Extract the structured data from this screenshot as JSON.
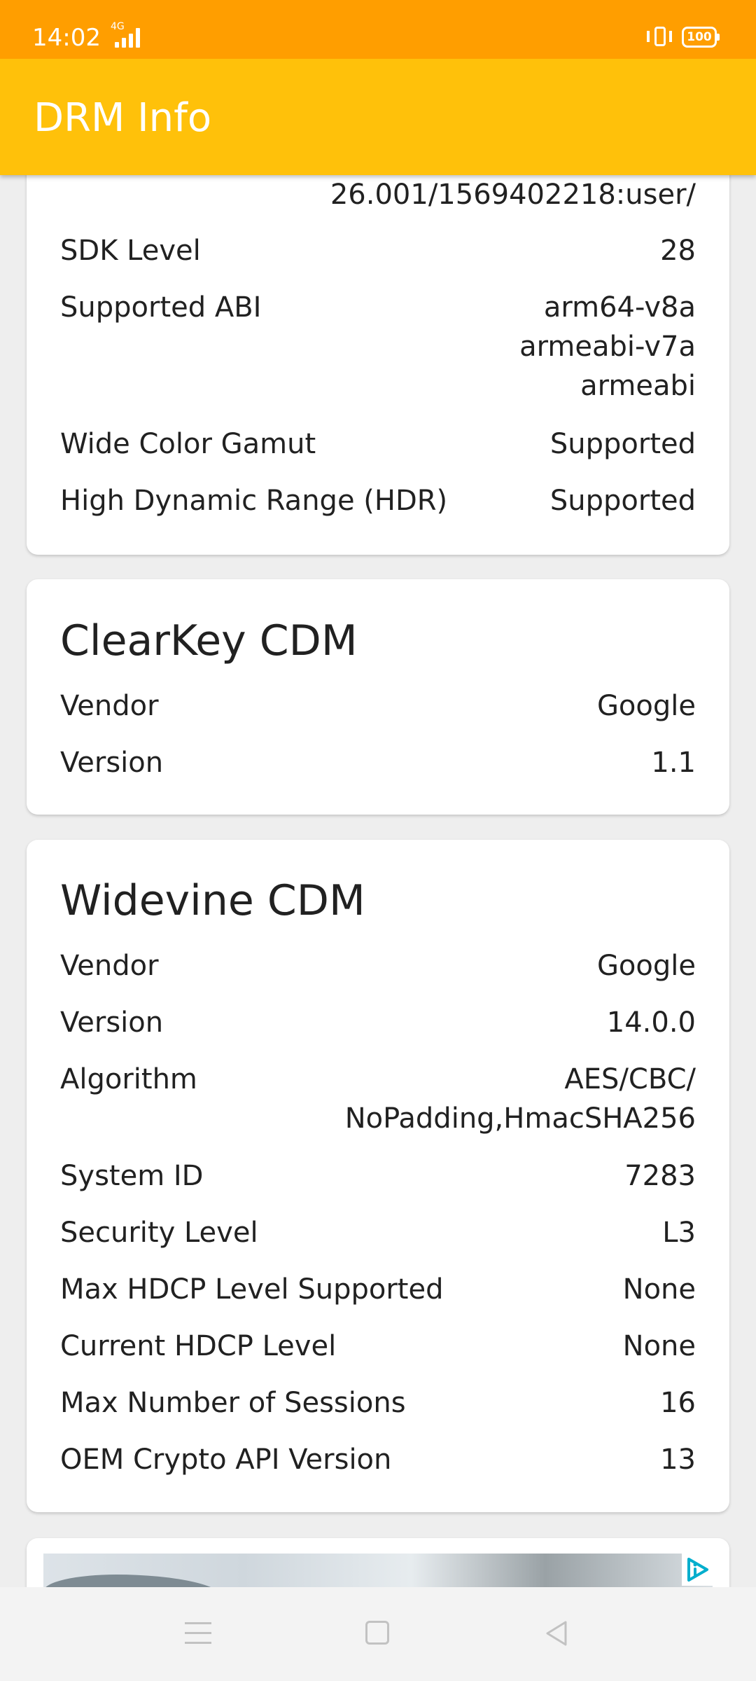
{
  "status_bar": {
    "time": "14:02",
    "network": "4G",
    "battery": "100"
  },
  "app_bar": {
    "title": "DRM Info"
  },
  "device_card": {
    "partial_value": "26.001/1569402218:user/",
    "rows": [
      {
        "key": "SDK Level",
        "value": "28"
      },
      {
        "key": "Supported ABI",
        "value": "arm64-v8a\narmeabi-v7a\narmeabi"
      },
      {
        "key": "Wide Color Gamut",
        "value": "Supported"
      },
      {
        "key": "High Dynamic Range (HDR)",
        "value": "Supported"
      }
    ]
  },
  "clearkey_card": {
    "title": "ClearKey CDM",
    "rows": [
      {
        "key": "Vendor",
        "value": "Google"
      },
      {
        "key": "Version",
        "value": "1.1"
      }
    ]
  },
  "widevine_card": {
    "title": "Widevine CDM",
    "rows": [
      {
        "key": "Vendor",
        "value": "Google"
      },
      {
        "key": "Version",
        "value": "14.0.0"
      },
      {
        "key": "Algorithm",
        "value": "AES/CBC/\nNoPadding,HmacSHA256"
      },
      {
        "key": "System ID",
        "value": "7283"
      },
      {
        "key": "Security Level",
        "value": "L3"
      },
      {
        "key": "Max HDCP Level Supported",
        "value": "None"
      },
      {
        "key": "Current HDCP Level",
        "value": "None"
      },
      {
        "key": "Max Number of Sessions",
        "value": "16"
      },
      {
        "key": "OEM Crypto API Version",
        "value": "13"
      }
    ]
  },
  "colors": {
    "status_bar": "#ff9e00",
    "app_bar": "#ffc10a",
    "ad_badge": "#00aecd"
  },
  "icons": [
    "signal-icon",
    "vibrate-icon",
    "battery-icon",
    "ad-choices-icon",
    "menu-icon",
    "home-icon",
    "back-icon"
  ]
}
